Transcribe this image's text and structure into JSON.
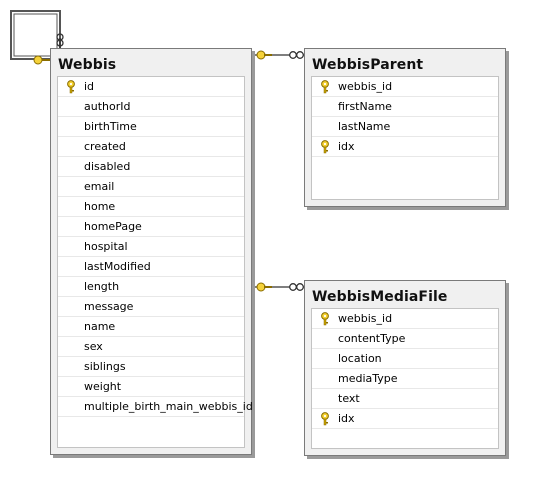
{
  "tables": [
    {
      "name": "Webbis",
      "columns": [
        {
          "name": "id",
          "key": true
        },
        {
          "name": "authorId",
          "key": false
        },
        {
          "name": "birthTime",
          "key": false
        },
        {
          "name": "created",
          "key": false
        },
        {
          "name": "disabled",
          "key": false
        },
        {
          "name": "email",
          "key": false
        },
        {
          "name": "home",
          "key": false
        },
        {
          "name": "homePage",
          "key": false
        },
        {
          "name": "hospital",
          "key": false
        },
        {
          "name": "lastModified",
          "key": false
        },
        {
          "name": "length",
          "key": false
        },
        {
          "name": "message",
          "key": false
        },
        {
          "name": "name",
          "key": false
        },
        {
          "name": "sex",
          "key": false
        },
        {
          "name": "siblings",
          "key": false
        },
        {
          "name": "weight",
          "key": false
        },
        {
          "name": "multiple_birth_main_webbis_id",
          "key": false
        }
      ]
    },
    {
      "name": "WebbisParent",
      "columns": [
        {
          "name": "webbis_id",
          "key": true
        },
        {
          "name": "firstName",
          "key": false
        },
        {
          "name": "lastName",
          "key": false
        },
        {
          "name": "idx",
          "key": true
        }
      ]
    },
    {
      "name": "WebbisMediaFile",
      "columns": [
        {
          "name": "webbis_id",
          "key": true
        },
        {
          "name": "contentType",
          "key": false
        },
        {
          "name": "location",
          "key": false
        },
        {
          "name": "mediaType",
          "key": false
        },
        {
          "name": "text",
          "key": false
        },
        {
          "name": "idx",
          "key": true
        }
      ]
    }
  ],
  "relationships": [
    {
      "from": "Webbis",
      "to": "Webbis",
      "kind": "self-reference"
    },
    {
      "from": "Webbis",
      "to": "WebbisParent",
      "kind": "one-to-many"
    },
    {
      "from": "Webbis",
      "to": "WebbisMediaFile",
      "kind": "one-to-many"
    }
  ],
  "colors": {
    "key_gold": "#e8c21a",
    "line": "#333333",
    "background": "#ffffff",
    "header": "#f0f0f0"
  },
  "icons": {
    "primary_key": "key-icon",
    "one_end": "key-icon",
    "many_end": "infinity-icon"
  }
}
